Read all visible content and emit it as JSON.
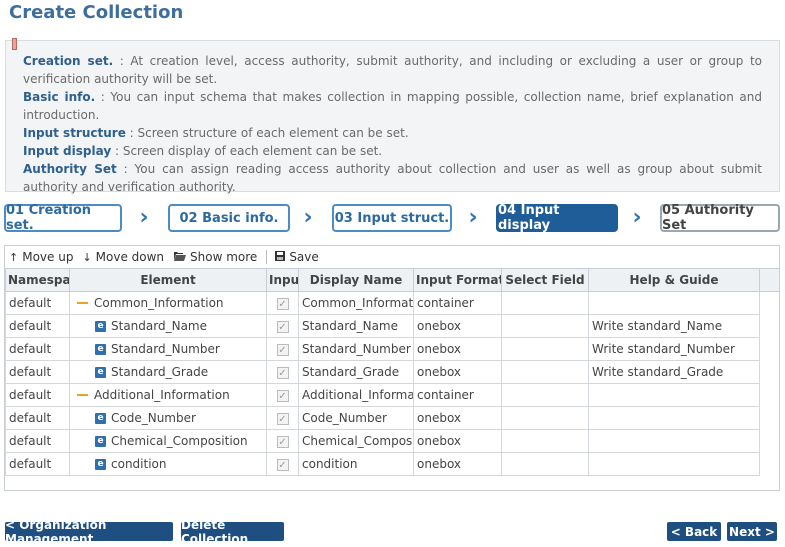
{
  "page": {
    "title": "Create Collection"
  },
  "info": [
    {
      "label": "Creation set.",
      "text": " : At creation level, access authority, submit authority, and including or excluding a user or group to verification authority will be set."
    },
    {
      "label": "Basic info.",
      "text": " : You can input schema that makes collection in mapping possible, collection name, brief explanation and introduction."
    },
    {
      "label": "Input structure",
      "text": " : Screen structure of each element can be set."
    },
    {
      "label": "Input display",
      "text": " : Screen display of each element can be set."
    },
    {
      "label": "Authority Set",
      "text": " : You can assign reading access authority about collection and user as well as group about submit authority and verification authority."
    }
  ],
  "steps": [
    "01 Creation set.",
    "02 Basic info.",
    "03 Input struct.",
    "04 Input display",
    "05 Authority Set"
  ],
  "toolbar": {
    "move_up": "Move up",
    "move_down": "Move down",
    "show_more": "Show more",
    "save": "Save"
  },
  "grid": {
    "columns": [
      "Namespace",
      "Element",
      "Input",
      "Display Name",
      "Input Format",
      "Select Field",
      "Help & Guide"
    ],
    "rows": [
      {
        "namespace": "default",
        "element": "Common_Information",
        "type": "group",
        "display_name": "Common_Information",
        "input_format": "container",
        "select_field": "",
        "help": ""
      },
      {
        "namespace": "default",
        "element": "Standard_Name",
        "type": "element",
        "display_name": "Standard_Name",
        "input_format": "onebox",
        "select_field": "",
        "help": "Write standard_Name"
      },
      {
        "namespace": "default",
        "element": "Standard_Number",
        "type": "element",
        "display_name": "Standard_Number",
        "input_format": "onebox",
        "select_field": "",
        "help": "Write standard_Number"
      },
      {
        "namespace": "default",
        "element": "Standard_Grade",
        "type": "element",
        "display_name": "Standard_Grade",
        "input_format": "onebox",
        "select_field": "",
        "help": "Write standard_Grade"
      },
      {
        "namespace": "default",
        "element": "Additional_Information",
        "type": "group",
        "display_name": "Additional_Information",
        "input_format": "container",
        "select_field": "",
        "help": ""
      },
      {
        "namespace": "default",
        "element": "Code_Number",
        "type": "element",
        "display_name": "Code_Number",
        "input_format": "onebox",
        "select_field": "",
        "help": ""
      },
      {
        "namespace": "default",
        "element": "Chemical_Composition",
        "type": "element",
        "display_name": "Chemical_Composition",
        "input_format": "onebox",
        "select_field": "",
        "help": ""
      },
      {
        "namespace": "default",
        "element": "condition",
        "type": "element",
        "display_name": "condition",
        "input_format": "onebox",
        "select_field": "",
        "help": ""
      }
    ]
  },
  "buttons": {
    "org_mgmt": "< Organization Management",
    "delete": "Delete Collection",
    "back": "< Back",
    "next": "Next >"
  },
  "icons": {
    "move_up": "arrow-up-icon",
    "move_down": "arrow-down-icon",
    "show_more": "folder-open-icon",
    "save": "save-icon",
    "element": "element-e-icon",
    "group": "group-dash-icon"
  }
}
